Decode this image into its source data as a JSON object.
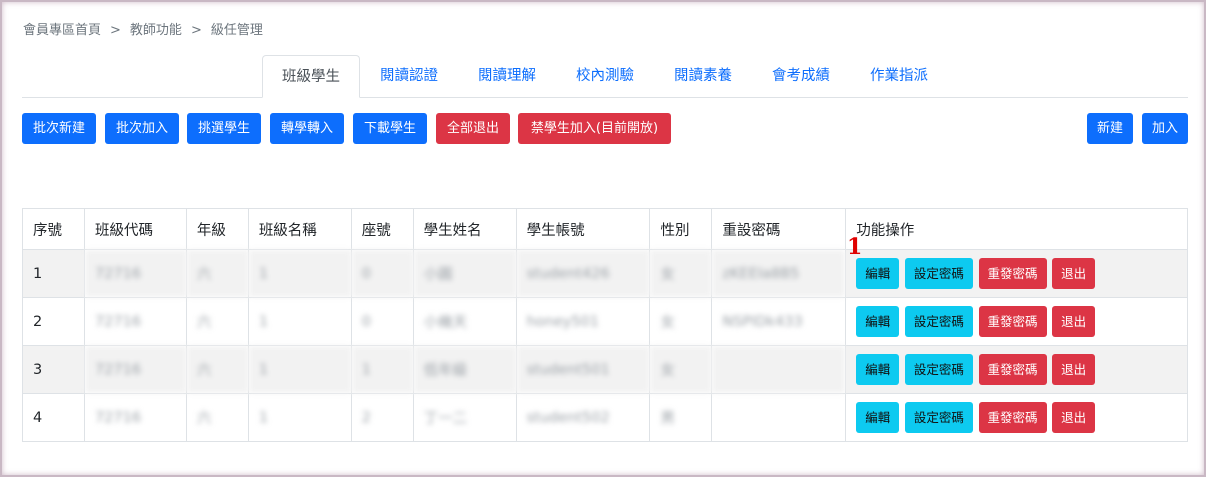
{
  "breadcrumb": [
    "會員專區首頁",
    "教師功能",
    "級任管理"
  ],
  "breadcrumb_separator": ">",
  "tabs": [
    {
      "label": "班級學生",
      "active": true
    },
    {
      "label": "閱讀認證"
    },
    {
      "label": "閱讀理解"
    },
    {
      "label": "校內測驗"
    },
    {
      "label": "閱讀素養"
    },
    {
      "label": "會考成績"
    },
    {
      "label": "作業指派"
    }
  ],
  "toolbar": {
    "batch_create": "批次新建",
    "batch_add": "批次加入",
    "pick_students": "挑選學生",
    "transfer_in": "轉學轉入",
    "download_students": "下載學生",
    "remove_all": "全部退出",
    "block_join": "禁學生加入(目前開放)",
    "create": "新建",
    "add": "加入"
  },
  "table": {
    "headers": [
      "序號",
      "班級代碼",
      "年級",
      "班級名稱",
      "座號",
      "學生姓名",
      "學生帳號",
      "性別",
      "重設密碼",
      "功能操作"
    ],
    "rows": [
      {
        "no": "1",
        "class_code": "72716",
        "grade": "六",
        "class_name": "1",
        "seat": "0",
        "name": "小圓",
        "account": "student426",
        "gender": "女",
        "reset_pw": "zKEEIa8B5"
      },
      {
        "no": "2",
        "class_code": "72716",
        "grade": "六",
        "class_name": "1",
        "seat": "0",
        "name": "小幾天",
        "account": "honey501",
        "gender": "女",
        "reset_pw": "NSPIDk433"
      },
      {
        "no": "3",
        "class_code": "72716",
        "grade": "六",
        "class_name": "1",
        "seat": "1",
        "name": "低年級",
        "account": "student501",
        "gender": "女",
        "reset_pw": ""
      },
      {
        "no": "4",
        "class_code": "72716",
        "grade": "六",
        "class_name": "1",
        "seat": "2",
        "name": "丁一二",
        "account": "student502",
        "gender": "男",
        "reset_pw": ""
      }
    ],
    "actions": {
      "edit": "編輯",
      "set_password": "設定密碼",
      "reissue_password": "重發密碼",
      "remove": "退出"
    }
  },
  "annotation_marker": "1",
  "colors": {
    "primary": "#0d6efd",
    "danger": "#dc3545",
    "info": "#0dcaf0",
    "marker": "#e00000"
  }
}
